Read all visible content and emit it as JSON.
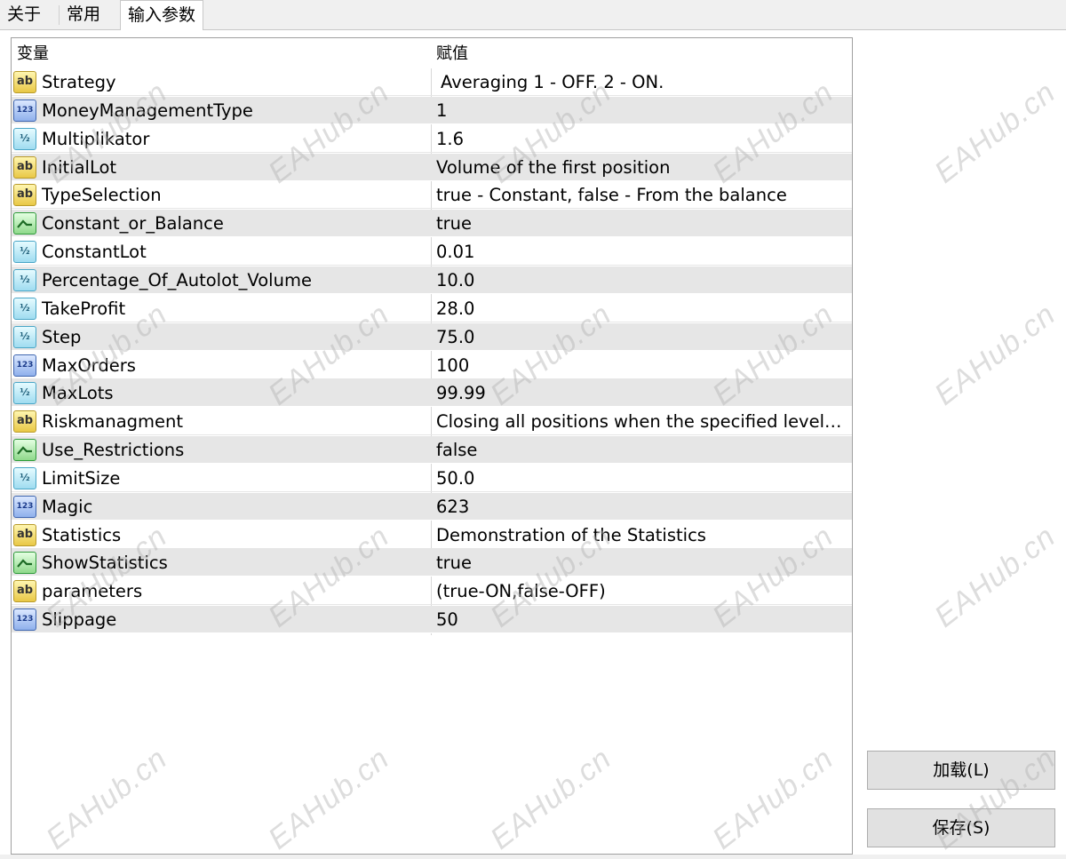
{
  "tabs": [
    {
      "label": "关于"
    },
    {
      "label": "常用"
    },
    {
      "label": "输入参数"
    }
  ],
  "table": {
    "col_variable": "变量",
    "col_value": "赋值",
    "rows": [
      {
        "type": "ab",
        "name": "Strategy",
        "value": "Averaging 1 - OFF. 2 - ON."
      },
      {
        "type": "123",
        "name": "MoneyManagementType",
        "value": "1"
      },
      {
        "type": "1/2",
        "name": "Multiplikator",
        "value": "1.6"
      },
      {
        "type": "ab",
        "name": "InitialLot",
        "value": "Volume of the first position"
      },
      {
        "type": "ab",
        "name": "TypeSelection",
        "value": "true - Constant, false - From the balance"
      },
      {
        "type": "bool",
        "name": "Constant_or_Balance",
        "value": "true"
      },
      {
        "type": "1/2",
        "name": "ConstantLot",
        "value": "0.01"
      },
      {
        "type": "1/2",
        "name": "Percentage_Of_Autolot_Volume",
        "value": "10.0"
      },
      {
        "type": "1/2",
        "name": "TakeProfit",
        "value": "28.0"
      },
      {
        "type": "1/2",
        "name": "Step",
        "value": "75.0"
      },
      {
        "type": "123",
        "name": "MaxOrders",
        "value": "100"
      },
      {
        "type": "1/2",
        "name": "MaxLots",
        "value": "99.99"
      },
      {
        "type": "ab",
        "name": "Riskmanagment",
        "value": "Closing all positions when the specified level is..."
      },
      {
        "type": "bool",
        "name": "Use_Restrictions",
        "value": "false"
      },
      {
        "type": "1/2",
        "name": "LimitSize",
        "value": "50.0"
      },
      {
        "type": "123",
        "name": "Magic",
        "value": "623"
      },
      {
        "type": "ab",
        "name": "Statistics",
        "value": "Demonstration of the Statistics"
      },
      {
        "type": "bool",
        "name": "ShowStatistics",
        "value": "true"
      },
      {
        "type": "ab",
        "name": "parameters",
        "value": "(true-ON,false-OFF)"
      },
      {
        "type": "123",
        "name": "Slippage",
        "value": "50"
      }
    ]
  },
  "buttons": {
    "load_label": "加载(L)",
    "save_label": "保存(S)"
  },
  "watermark": "EAHub.cn"
}
